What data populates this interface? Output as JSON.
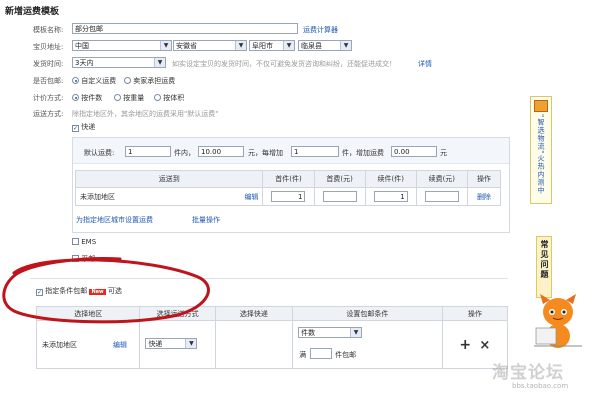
{
  "page_title": "新增运费模板",
  "form": {
    "template_name_label": "模板名称:",
    "template_name_value": "部分包邮",
    "calculator_link": "运费计算器",
    "address_label": "宝贝地址:",
    "country": "中国",
    "province": "安徽省",
    "city": "阜阳市",
    "county": "临泉县",
    "ship_time_label": "发货时间:",
    "ship_time_value": "3天内",
    "ship_time_hint": "如实设定宝贝的发货时间，不仅可避免发货咨询和纠纷，还能促进成交！",
    "ship_time_detail": "详情",
    "free_label": "是否包邮:",
    "free_opt1": "自定义运费",
    "free_opt2": "卖家承担运费",
    "calc_label": "计价方式:",
    "calc_opt1": "按件数",
    "calc_opt2": "按重量",
    "calc_opt3": "按体积",
    "method_label": "运送方式:",
    "method_hint": "除指定地区外，其余地区的运费采用\"默认运费\""
  },
  "express": {
    "label": "快递",
    "default_label": "默认运费:",
    "default_qty": "1",
    "qty_unit": "件内，",
    "default_fee": "10.00",
    "fee_text": "元，每增加",
    "add_qty": "1",
    "add_unit": "件，增加运费",
    "add_fee": "0.00",
    "add_yuan": "元",
    "table_headers": [
      "运送到",
      "首件(件)",
      "首费(元)",
      "续件(件)",
      "续费(元)",
      "操作"
    ],
    "row": {
      "region": "未添加地区",
      "edit": "编辑",
      "first": "1",
      "first_fee": "",
      "next": "1",
      "next_fee": "",
      "delete": "删除"
    },
    "bottom_link": "为指定地区城市设置运费",
    "batch_link": "批量操作"
  },
  "ems_label": "EMS",
  "mail_label": "平邮",
  "conditional": {
    "label": "指定条件包邮",
    "new_badge": "New",
    "optional": "可选",
    "headers": [
      "选择地区",
      "选择运送方式",
      "选择快递",
      "设置包邮条件",
      "操作"
    ],
    "row": {
      "region": "未添加地区",
      "edit": "编辑",
      "method": "快递",
      "condition": "件数",
      "full_prefix": "满",
      "full_suffix": "件包邮",
      "add": "+",
      "del": "×"
    }
  },
  "side": {
    "promo_text": "\"智选物流\"火热内测中",
    "faq_text": "常见问题"
  },
  "watermark": {
    "main": "淘宝论坛",
    "url": "bbs.taobao.com"
  },
  "colors": {
    "annotation": "#c0141c",
    "accent": "#1f58b5",
    "panel": "#f3f7fb"
  }
}
